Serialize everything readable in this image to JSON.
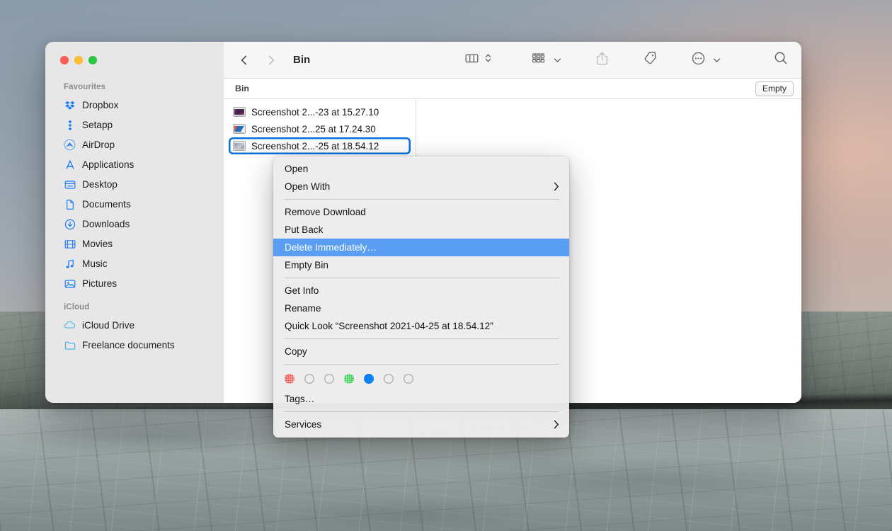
{
  "window": {
    "title": "Bin",
    "traffic_lights": [
      "close",
      "minimize",
      "maximize"
    ]
  },
  "sidebar": {
    "sections": [
      {
        "title": "Favourites",
        "items": [
          {
            "label": "Dropbox",
            "icon": "dropbox-icon"
          },
          {
            "label": "Setapp",
            "icon": "setapp-icon"
          },
          {
            "label": "AirDrop",
            "icon": "airdrop-icon"
          },
          {
            "label": "Applications",
            "icon": "applications-icon"
          },
          {
            "label": "Desktop",
            "icon": "desktop-icon"
          },
          {
            "label": "Documents",
            "icon": "documents-icon"
          },
          {
            "label": "Downloads",
            "icon": "downloads-icon"
          },
          {
            "label": "Movies",
            "icon": "movies-icon"
          },
          {
            "label": "Music",
            "icon": "music-icon"
          },
          {
            "label": "Pictures",
            "icon": "pictures-icon"
          }
        ]
      },
      {
        "title": "iCloud",
        "items": [
          {
            "label": "iCloud Drive",
            "icon": "cloud-icon"
          },
          {
            "label": "Freelance documents",
            "icon": "folder-icon"
          }
        ]
      }
    ]
  },
  "toolbar": {
    "back": "‹",
    "forward": "›",
    "title": "Bin",
    "buttons": [
      {
        "name": "view-mode-column",
        "icon": "column-view-icon"
      },
      {
        "name": "group-by",
        "icon": "group-by-icon"
      },
      {
        "name": "share",
        "icon": "share-icon"
      },
      {
        "name": "tags",
        "icon": "tag-icon"
      },
      {
        "name": "more-actions",
        "icon": "ellipsis-circle-icon"
      },
      {
        "name": "search",
        "icon": "search-icon"
      }
    ]
  },
  "pathbar": {
    "label": "Bin",
    "empty_button": "Empty"
  },
  "files": [
    {
      "name": "Screenshot 2...-23 at 15.27.10",
      "selected": false,
      "thumb": "#5b2f52"
    },
    {
      "name": "Screenshot 2...25 at 17.24.30",
      "selected": false,
      "thumb": "#1d6fc0"
    },
    {
      "name": "Screenshot 2...-25 at 18.54.12",
      "selected": true,
      "thumb": "#7d8898"
    }
  ],
  "context_menu": {
    "groups": [
      {
        "items": [
          {
            "label": "Open",
            "submenu": false,
            "highlight": false
          },
          {
            "label": "Open With",
            "submenu": true,
            "highlight": false
          }
        ]
      },
      {
        "items": [
          {
            "label": "Remove Download",
            "submenu": false,
            "highlight": false
          },
          {
            "label": "Put Back",
            "submenu": false,
            "highlight": false
          },
          {
            "label": "Delete Immediately…",
            "submenu": false,
            "highlight": true
          },
          {
            "label": "Empty Bin",
            "submenu": false,
            "highlight": false
          }
        ]
      },
      {
        "items": [
          {
            "label": "Get Info",
            "submenu": false,
            "highlight": false
          },
          {
            "label": "Rename",
            "submenu": false,
            "highlight": false
          },
          {
            "label": "Quick Look “Screenshot 2021-04-25 at 18.54.12”",
            "submenu": false,
            "highlight": false
          }
        ]
      },
      {
        "items": [
          {
            "label": "Copy",
            "submenu": false,
            "highlight": false
          }
        ]
      }
    ],
    "tag_colors": [
      {
        "name": "red",
        "color": "#f0524a",
        "filled": true,
        "textured": true
      },
      {
        "name": "orange",
        "color": "",
        "filled": false,
        "textured": false
      },
      {
        "name": "yellow",
        "color": "",
        "filled": false,
        "textured": false
      },
      {
        "name": "green",
        "color": "#2fce4a",
        "filled": true,
        "textured": true
      },
      {
        "name": "blue",
        "color": "#0b82f0",
        "filled": true,
        "textured": false
      },
      {
        "name": "purple",
        "color": "",
        "filled": false,
        "textured": false
      },
      {
        "name": "grey",
        "color": "",
        "filled": false,
        "textured": false
      }
    ],
    "tags_item": "Tags…",
    "services_item": "Services",
    "highlight_color": "#5a9ef3"
  }
}
